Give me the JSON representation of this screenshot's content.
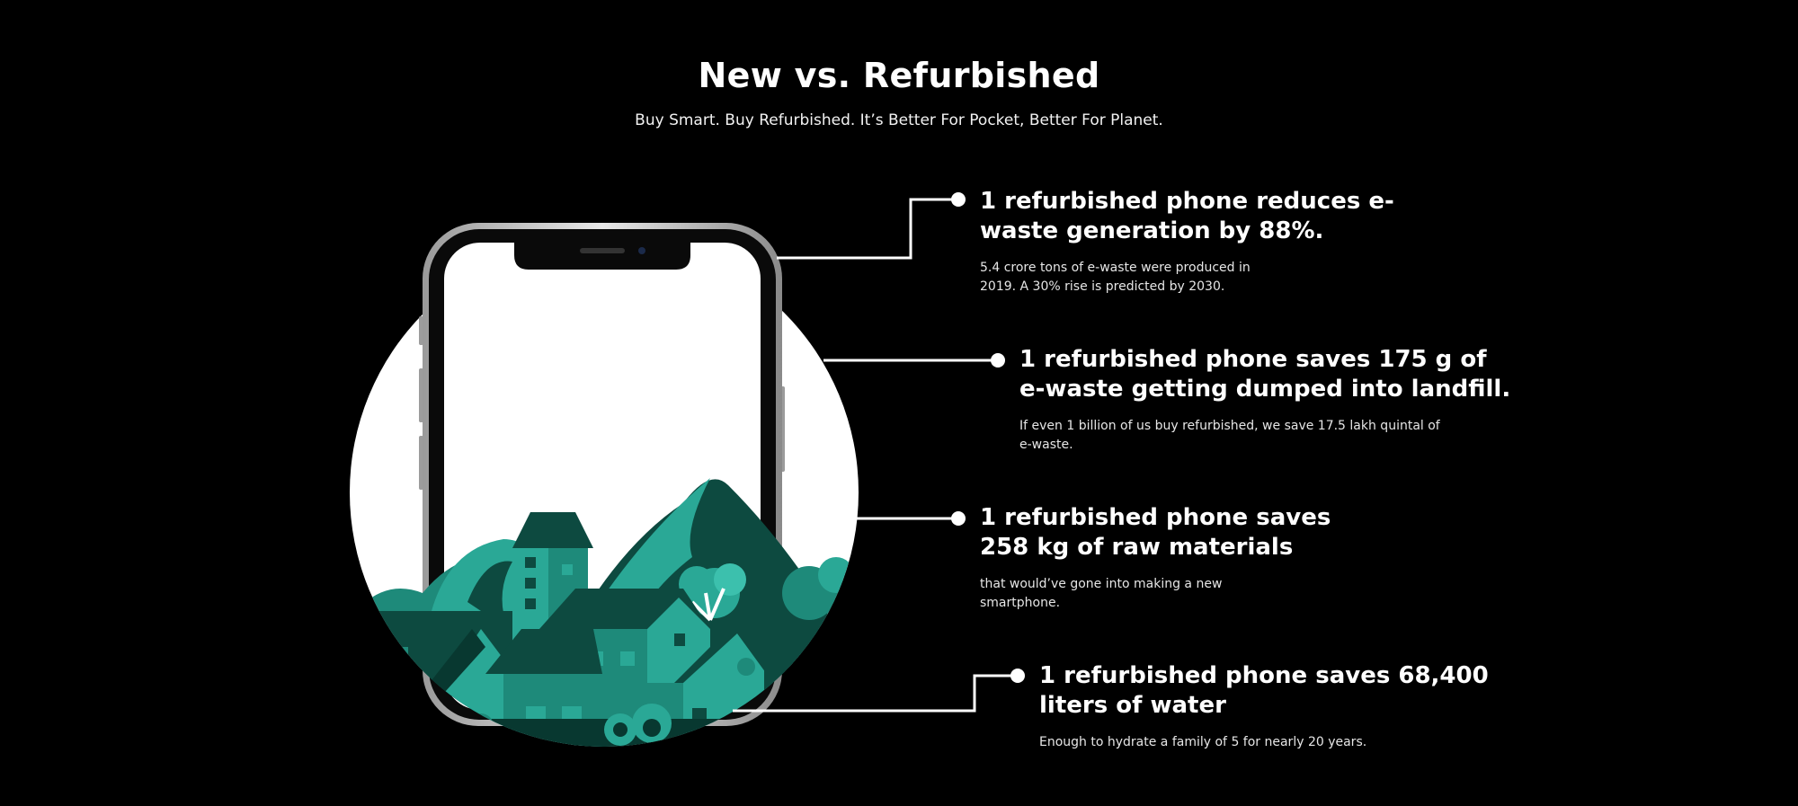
{
  "header": {
    "title": "New vs. Refurbished",
    "subtitle": "Buy Smart. Buy Refurbished. It’s Better For Pocket, Better For Planet."
  },
  "facts": [
    {
      "heading": "1 refurbished phone reduces e-waste generation by 88%.",
      "detail": "5.4 crore tons of e-waste were produced in 2019. A 30% rise is predicted by 2030."
    },
    {
      "heading": "1 refurbished phone saves 175 g of e-waste getting dumped into landfill.",
      "detail": "If even 1 billion of us buy refurbished, we save 17.5 lakh quintal of e-waste."
    },
    {
      "heading": "1 refurbished phone saves 258 kg of raw materials",
      "detail": "that would’ve gone into making a new smartphone."
    },
    {
      "heading": "1 refurbished phone saves 68,400 liters of water",
      "detail": "Enough to hydrate a family of 5 for nearly 20 years."
    }
  ],
  "colors": {
    "background": "#000000",
    "text": "#ffffff",
    "teal_light": "#2aa896",
    "teal_mid": "#1e8a7a",
    "teal_dark": "#0d4a40",
    "teal_darkest": "#083830"
  },
  "icons": {
    "illustration": "smartphone-village-illustration"
  }
}
